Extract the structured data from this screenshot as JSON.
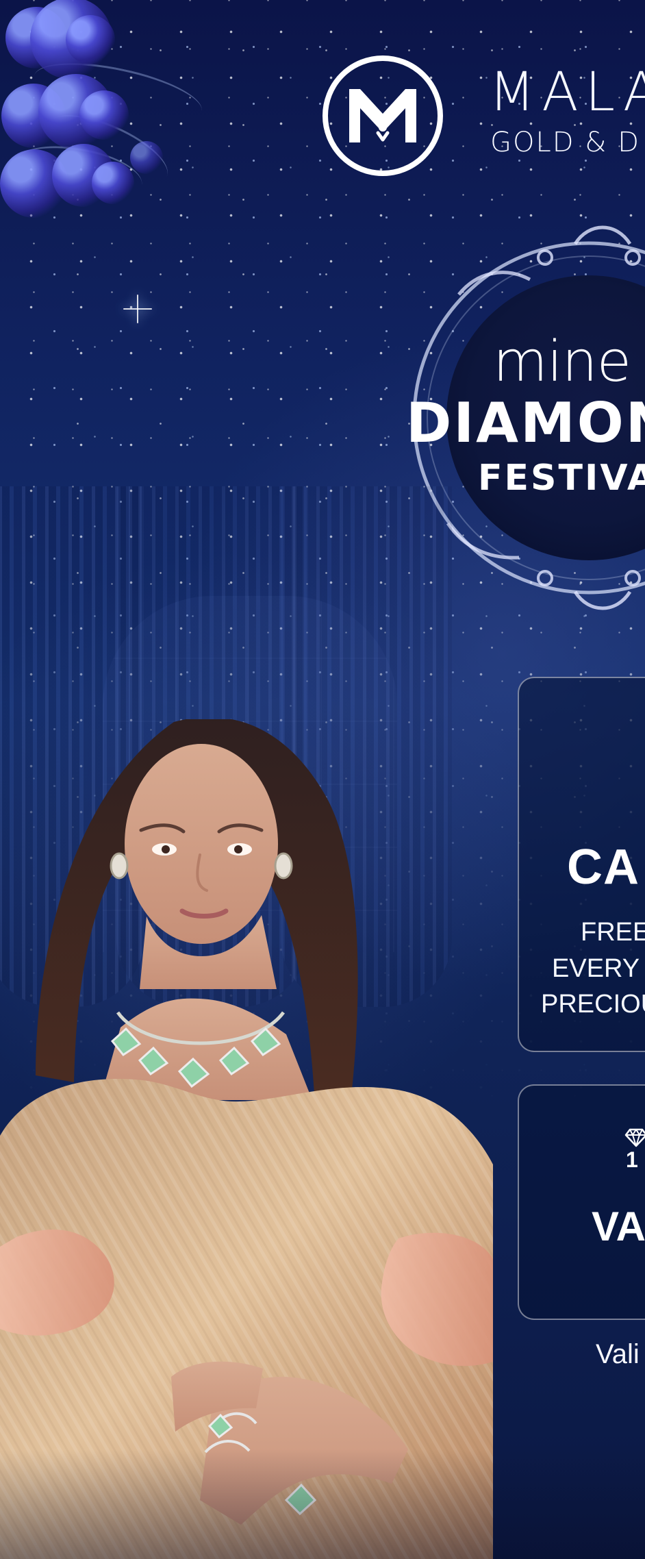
{
  "brand": {
    "name": "MALA",
    "subtitle": "GOLD & D",
    "logo_icon": "malabar-m-logo-icon"
  },
  "festival": {
    "line1": "mine",
    "line2": "DIAMON",
    "line3": "FESTIVAL"
  },
  "offers": {
    "primary": {
      "title": "CA",
      "line1": "FREE",
      "line2": "EVERY U",
      "line3": "PRECIOU"
    },
    "secondary": {
      "number": "1",
      "title": "VA",
      "icon": "diamond-icon"
    },
    "validity": "Vali"
  },
  "colors": {
    "background_top": "#0b1448",
    "background_bottom": "#0b1843",
    "text": "#ffffff"
  }
}
